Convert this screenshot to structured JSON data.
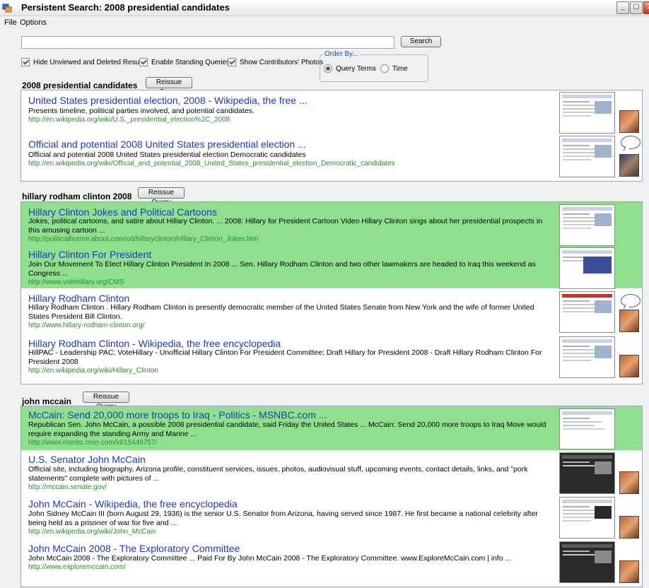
{
  "window": {
    "title": "Persistent Search: 2008 presidential candidates",
    "min": "_",
    "max": "▢",
    "close": "X"
  },
  "menu": [
    {
      "label": "File"
    },
    {
      "label": "Options"
    }
  ],
  "search": {
    "value": "",
    "button": "Search"
  },
  "options": {
    "hide_unviewed": "Hide Unviewed and Deleted Results",
    "standing_queries": "Enable Standing Queries",
    "contributor_photos": "Show Contributors' Photos"
  },
  "order_by": {
    "legend": "Order By...",
    "query_terms": "Query Terms",
    "time": "Time",
    "selected": "Query Terms"
  },
  "reissue_label": "Reissue Query",
  "queries": [
    {
      "label": "2008 presidential candidates",
      "results": [
        {
          "title": "United States presidential election, 2008 - Wikipedia, the free ...",
          "desc": "Presents timeline, political parties involved, and potential candidates.",
          "url": "http://en.wikipedia.org/wiki/U.S._presidential_election%2C_2008"
        },
        {
          "title": "Official and potential 2008 United States presidential election ...",
          "desc": "Official and potential 2008 United States presidential election Democratic candidates",
          "url": "http://en.wikipedia.org/wiki/Official_and_potential_2008_United_States_presidential_election_Democratic_candidates"
        }
      ]
    },
    {
      "label": "hillary rodham clinton 2008",
      "results": [
        {
          "title": "Hillary Clinton Jokes and Political Cartoons",
          "desc": "Jokes, political cartoons, and satire about Hillary Clinton. ... 2008: Hillary for President Cartoon Video Hillary Clinton sings about her presidential prospects in this amusing cartoon ...",
          "url": "http://politicalhumor.about.com/od/hillaryclinton/Hillary_Clinton_Jokes.htm"
        },
        {
          "title": "Hillary Clinton For President",
          "desc": "Join Our Movement To Elect Hillary Clinton President In 2008 ... Sen. Hillary Rodham Clinton and two other lawmakers are headed to Iraq this weekend as Congress ...",
          "url": "http://www.votehillary.org/CMS"
        },
        {
          "title": "Hillary Rodham Clinton",
          "desc": "Hillary Rodham Clinton . Hillary Rodham Clinton is presently democratic member of the United States Senate from New York and the wife of former United States President Bill Clinton.",
          "url": "http://www.hillary-rodham-clinton.org/"
        },
        {
          "title": "Hillary Rodham Clinton - Wikipedia, the free encyclopedia",
          "desc": "HillPAC - Leadership PAC; VoteHillary - Unofficial Hillary Clinton For President Committee; Draft Hillary for President 2008 - Draft Hillary Rodham Clinton For President 2008",
          "url": "http://en.wikipedia.org/wiki/Hillary_Clinton"
        }
      ]
    },
    {
      "label": "john mccain",
      "results": [
        {
          "title": "McCain: Send 20,000 more troops to Iraq - Politics - MSNBC.com ...",
          "desc": "Republican Sen. John McCain, a possible 2008 presidential candidate, said Friday the United States ... McCain: Send 20,000 more troops to Iraq Move would require expanding the standing Army and Marine ...",
          "url": "http://www.msnbc.msn.com/id/15446757/"
        },
        {
          "title": "U.S. Senator John McCain",
          "desc": "Official site, including biography, Arizona profile, constituent services, issues, photos, audiovisual stuff, upcoming events, contact details, links, and \"pork statements\" complete with pictures of ...",
          "url": "http://mccain.senate.gov/"
        },
        {
          "title": "John McCain - Wikipedia, the free encyclopedia",
          "desc": "John Sidney McCain III (born August 29, 1936) is the senior U.S. Senator from Arizona, having served since 1987. He first became a national celebrity after being held as a prisoner of war for five and ...",
          "url": "http://en.wikipedia.org/wiki/John_McCain"
        },
        {
          "title": "John McCain 2008 - The Exploratory Committee",
          "desc": "John McCain 2008 - The Exploratory Committee ... Paid For By John McCain 2008 - The Exploratory Committee. www.ExploreMcCain.com | info ...",
          "url": "http://www.exploremccain.com/"
        }
      ]
    }
  ]
}
